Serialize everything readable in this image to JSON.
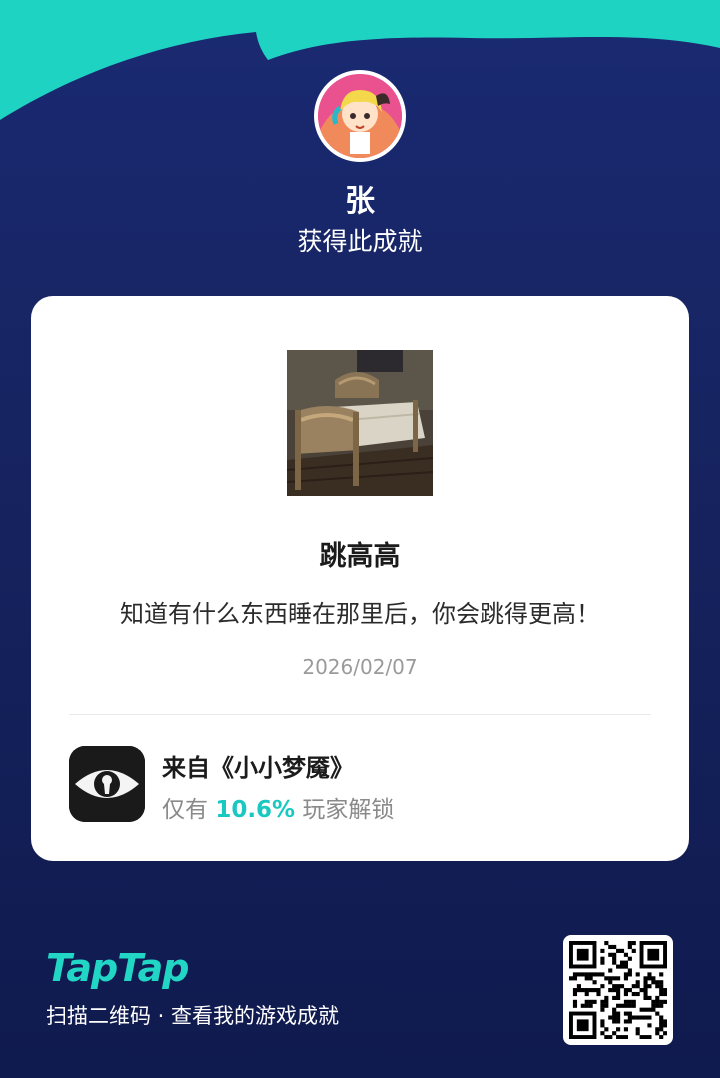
{
  "profile": {
    "username": "张",
    "subtitle": "获得此成就"
  },
  "achievement": {
    "title": "跳高高",
    "description": "知道有什么东西睡在那里后，你会跳得更高！",
    "date": "2026/02/07"
  },
  "game": {
    "source": "来自《小小梦魇》",
    "unlock_prefix": "仅有",
    "unlock_percent": "10.6%",
    "unlock_suffix": "玩家解锁"
  },
  "footer": {
    "brand": "TapTap",
    "cta": "扫描二维码 · 查看我的游戏成就"
  },
  "colors": {
    "accent": "#22d6c6",
    "background": "#141d56",
    "card": "#ffffff"
  },
  "icons": {
    "avatar": "anime-girl-avatar",
    "achievement": "bed-image",
    "game": "eye-keyhole-icon",
    "qr": "qr-code"
  }
}
